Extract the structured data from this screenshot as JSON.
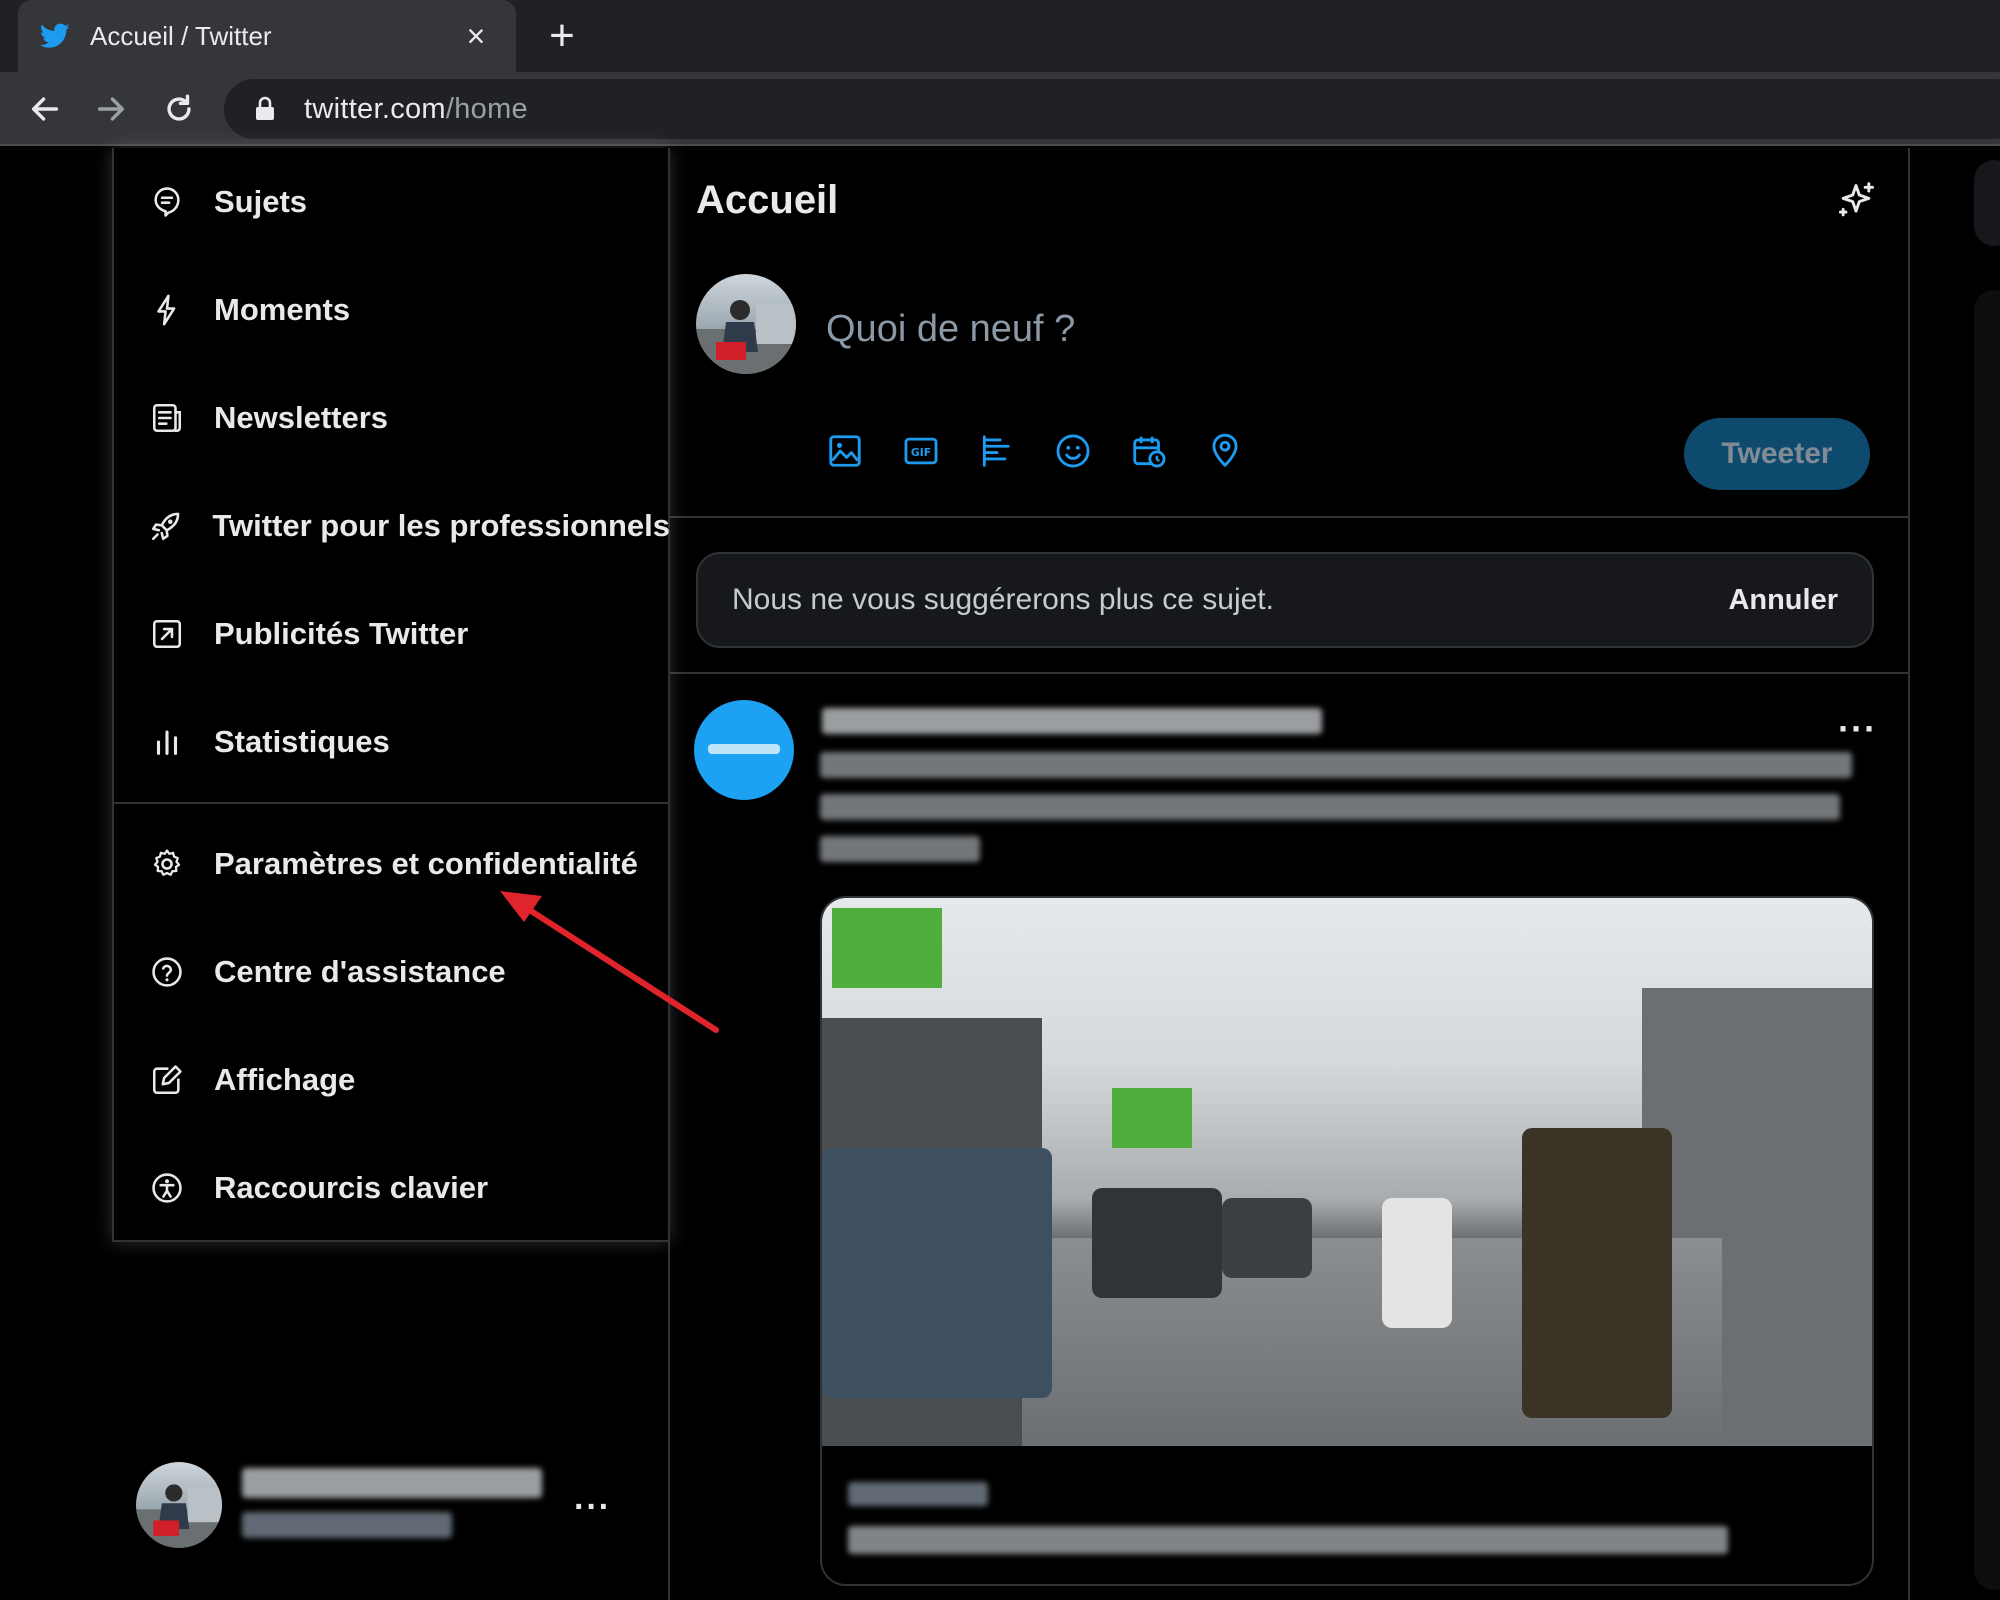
{
  "browser": {
    "tab_title": "Accueil / Twitter",
    "tab_close": "×",
    "new_tab": "+",
    "url_host": "twitter.com",
    "url_path": "/home"
  },
  "menu": {
    "items": [
      {
        "label": "Sujets",
        "icon": "topics-icon"
      },
      {
        "label": "Moments",
        "icon": "lightning-icon"
      },
      {
        "label": "Newsletters",
        "icon": "newsletter-icon"
      },
      {
        "label": "Twitter pour les professionnels",
        "icon": "rocket-icon"
      },
      {
        "label": "Publicités Twitter",
        "icon": "external-arrow-icon"
      },
      {
        "label": "Statistiques",
        "icon": "bar-chart-icon"
      },
      {
        "label": "Paramètres et confidentialité",
        "icon": "gear-icon"
      },
      {
        "label": "Centre d'assistance",
        "icon": "help-circle-icon"
      },
      {
        "label": "Affichage",
        "icon": "edit-display-icon"
      },
      {
        "label": "Raccourcis clavier",
        "icon": "accessibility-icon"
      }
    ]
  },
  "timeline": {
    "title": "Accueil",
    "compose_placeholder": "Quoi de neuf ?",
    "tweet_button": "Tweeter",
    "tools": [
      "image-icon",
      "gif-icon",
      "poll-icon",
      "emoji-icon",
      "schedule-icon",
      "location-icon"
    ],
    "notice_text": "Nous ne vous suggérerons plus ce sujet.",
    "notice_button": "Annuler",
    "tweet_more": "···"
  },
  "account": {
    "more": "···"
  },
  "colors": {
    "accent": "#1d9bf0",
    "annotation_arrow": "#e0242b",
    "background": "#000000",
    "border": "#2f3336"
  }
}
